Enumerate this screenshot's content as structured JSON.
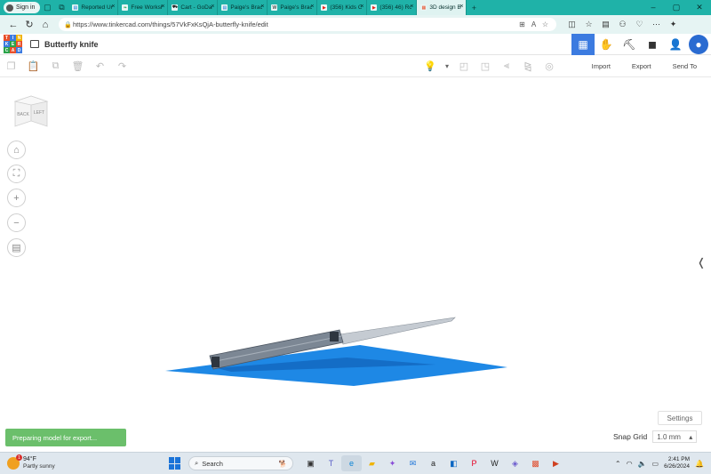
{
  "browser": {
    "signin_label": "Sign in",
    "tabs": [
      {
        "title": "Reported Uni",
        "favicon": "doc-icon",
        "active": false
      },
      {
        "title": "Free Workshe",
        "favicon": "leaf-icon",
        "active": false
      },
      {
        "title": "Cart - GoDad",
        "favicon": "cart-icon",
        "active": false
      },
      {
        "title": "Paige's Bracel",
        "favicon": "doc-icon",
        "active": false
      },
      {
        "title": "Paige's Bracel",
        "favicon": "wix-icon",
        "active": false
      },
      {
        "title": "(356) Kids Gr",
        "favicon": "youtube-icon",
        "active": false
      },
      {
        "title": "(356) 46) Rob",
        "favicon": "youtube-icon",
        "active": false
      },
      {
        "title": "3D design Bu",
        "favicon": "tinkercad-icon",
        "active": true
      }
    ],
    "url": "https://www.tinkercad.com/things/57VkFxKsQjA-butterfly-knife/edit"
  },
  "app": {
    "logo_letters": [
      "T",
      "I",
      "N",
      "K",
      "E",
      "R",
      "C",
      "A",
      "D"
    ],
    "design_title": "Butterfly knife",
    "toolbar": {
      "import_label": "Import",
      "export_label": "Export",
      "send_to_label": "Send To"
    }
  },
  "viewcube": {
    "back_label": "BACK",
    "left_label": "LEFT"
  },
  "workplane": {
    "toast_text": "Preparing model for export...",
    "settings_label": "Settings",
    "snap_label": "Snap Grid",
    "snap_value": "1.0 mm"
  },
  "taskbar": {
    "temperature": "94°F",
    "condition": "Partly sunny",
    "weather_badge": "1",
    "search_placeholder": "Search",
    "time": "2:41 PM",
    "date": "6/26/2024"
  },
  "colors": {
    "browser_chrome": "#1fb2a8",
    "tinkercad_blue": "#3c7be0",
    "workplane_blue": "#1e88e5",
    "toast_green": "#6bbf6b"
  }
}
